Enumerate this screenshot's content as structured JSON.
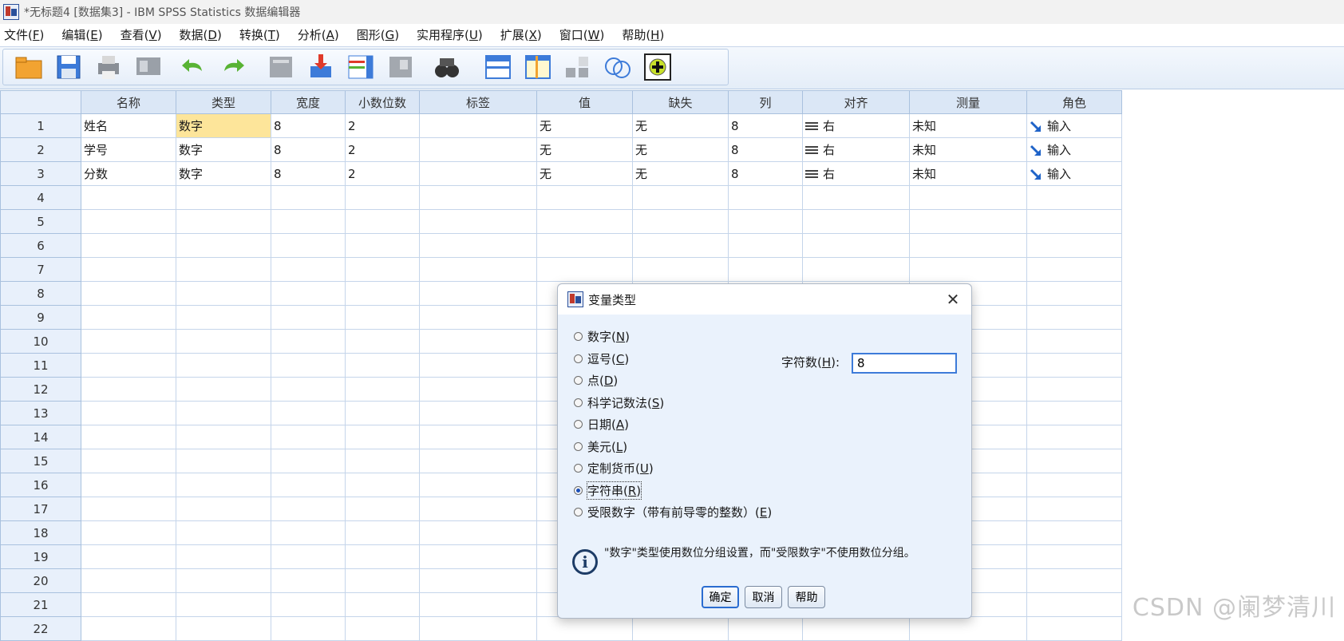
{
  "window": {
    "title": "*无标题4 [数据集3] - IBM SPSS Statistics 数据编辑器"
  },
  "menu": [
    {
      "label": "文件(",
      "mn": "F",
      "end": ")"
    },
    {
      "label": "编辑(",
      "mn": "E",
      "end": ")"
    },
    {
      "label": "查看(",
      "mn": "V",
      "end": ")"
    },
    {
      "label": "数据(",
      "mn": "D",
      "end": ")"
    },
    {
      "label": "转换(",
      "mn": "T",
      "end": ")"
    },
    {
      "label": "分析(",
      "mn": "A",
      "end": ")"
    },
    {
      "label": "图形(",
      "mn": "G",
      "end": ")"
    },
    {
      "label": "实用程序(",
      "mn": "U",
      "end": ")"
    },
    {
      "label": "扩展(",
      "mn": "X",
      "end": ")"
    },
    {
      "label": "窗口(",
      "mn": "W",
      "end": ")"
    },
    {
      "label": "帮助(",
      "mn": "H",
      "end": ")"
    }
  ],
  "toolbar_icons": [
    "open-folder-icon",
    "save-icon",
    "print-icon",
    "dialog-recall-icon",
    "undo-icon",
    "redo-icon",
    "goto-case-icon",
    "goto-variable-icon",
    "variables-icon",
    "run-descriptives-icon",
    "find-icon",
    "insert-cases-icon",
    "insert-variable-icon",
    "split-file-icon",
    "weight-cases-icon",
    "select-cases-icon",
    "value-labels-icon",
    "use-sets-icon"
  ],
  "columns": [
    "名称",
    "类型",
    "宽度",
    "小数位数",
    "标签",
    "值",
    "缺失",
    "列",
    "对齐",
    "测量",
    "角色"
  ],
  "rows": [
    {
      "num": "1",
      "name": "姓名",
      "type": "数字",
      "width": "8",
      "decimals": "2",
      "label": "",
      "values": "无",
      "missing": "无",
      "columns": "8",
      "align": "右",
      "measure": "未知",
      "role": "输入"
    },
    {
      "num": "2",
      "name": "学号",
      "type": "数字",
      "width": "8",
      "decimals": "2",
      "label": "",
      "values": "无",
      "missing": "无",
      "columns": "8",
      "align": "右",
      "measure": "未知",
      "role": "输入"
    },
    {
      "num": "3",
      "name": "分数",
      "type": "数字",
      "width": "8",
      "decimals": "2",
      "label": "",
      "values": "无",
      "missing": "无",
      "columns": "8",
      "align": "右",
      "measure": "未知",
      "role": "输入"
    }
  ],
  "empty_rows": [
    "4",
    "5",
    "6",
    "7",
    "8",
    "9",
    "10",
    "11",
    "12",
    "13",
    "14",
    "15",
    "16",
    "17",
    "18",
    "19",
    "20",
    "21",
    "22"
  ],
  "dialog": {
    "title": "变量类型",
    "options": [
      {
        "label": "数字(",
        "mn": "N",
        "end": ")",
        "selected": false
      },
      {
        "label": "逗号(",
        "mn": "C",
        "end": ")",
        "selected": false
      },
      {
        "label": "点(",
        "mn": "D",
        "end": ")",
        "selected": false
      },
      {
        "label": "科学记数法(",
        "mn": "S",
        "end": ")",
        "selected": false
      },
      {
        "label": "日期(",
        "mn": "A",
        "end": ")",
        "selected": false
      },
      {
        "label": "美元(",
        "mn": "L",
        "end": ")",
        "selected": false
      },
      {
        "label": "定制货币(",
        "mn": "U",
        "end": ")",
        "selected": false
      },
      {
        "label": "字符串(",
        "mn": "R",
        "end": ")",
        "selected": true
      },
      {
        "label": "受限数字（带有前导零的整数）(",
        "mn": "E",
        "end": ")",
        "selected": false
      }
    ],
    "chars_label_pre": "字符数(",
    "chars_label_mn": "H",
    "chars_label_post": "):",
    "chars_value": "8",
    "info": "\"数字\"类型使用数位分组设置，而\"受限数字\"不使用数位分组。",
    "buttons": {
      "ok": "确定",
      "cancel": "取消",
      "help": "帮助"
    }
  },
  "watermark": "CSDN @阑梦清川",
  "colors": {
    "selected_cell": "#fde59a",
    "header": "#dbe7f6",
    "dialog_bg": "#eaf2fc",
    "focus_border": "#2a6cd0"
  }
}
